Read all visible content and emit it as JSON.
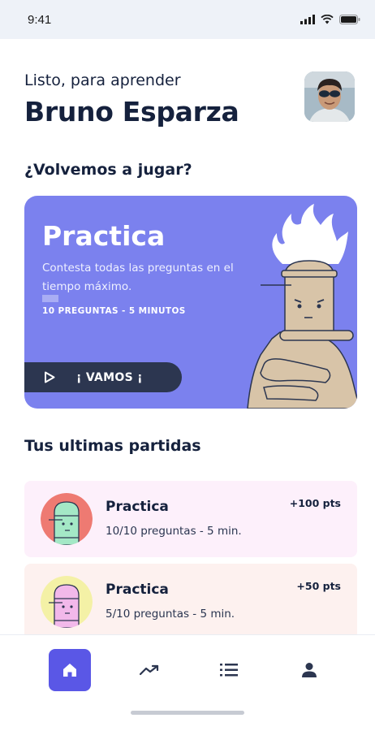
{
  "status_bar": {
    "time": "9:41",
    "icons": [
      "signal-icon",
      "wifi-icon",
      "battery-icon"
    ]
  },
  "header": {
    "greeting": "Listo, para aprender",
    "user_name": "Bruno Esparza"
  },
  "play_section": {
    "title": "¿Volvemos a jugar?",
    "card": {
      "title": "Practica",
      "description": "Contesta todas las preguntas en el tiempo máximo.",
      "meta": "10 PREGUNTAS - 5 MINUTOS",
      "button_label": "¡ VAMOS ¡",
      "button_icon": "play-icon"
    }
  },
  "recent_section": {
    "title": "Tus ultimas partidas",
    "games": [
      {
        "title": "Practica",
        "detail": "10/10 preguntas - 5 min.",
        "points": "+100 pts"
      },
      {
        "title": "Practica",
        "detail": "5/10 preguntas - 5 min.",
        "points": "+50 pts"
      }
    ]
  },
  "bottom_nav": {
    "items": [
      {
        "icon": "home-icon",
        "active": true
      },
      {
        "icon": "trending-up-icon",
        "active": false
      },
      {
        "icon": "list-icon",
        "active": false
      },
      {
        "icon": "user-icon",
        "active": false
      }
    ]
  },
  "colors": {
    "primary": "#5a57e6",
    "card_purple": "#7b81ee",
    "navy": "#15213d",
    "button_dark": "#2c3650",
    "mascot_skin": "#d8c4a8",
    "game_card_1": "#fdf0fb",
    "game_card_2": "#fdf1ef"
  }
}
